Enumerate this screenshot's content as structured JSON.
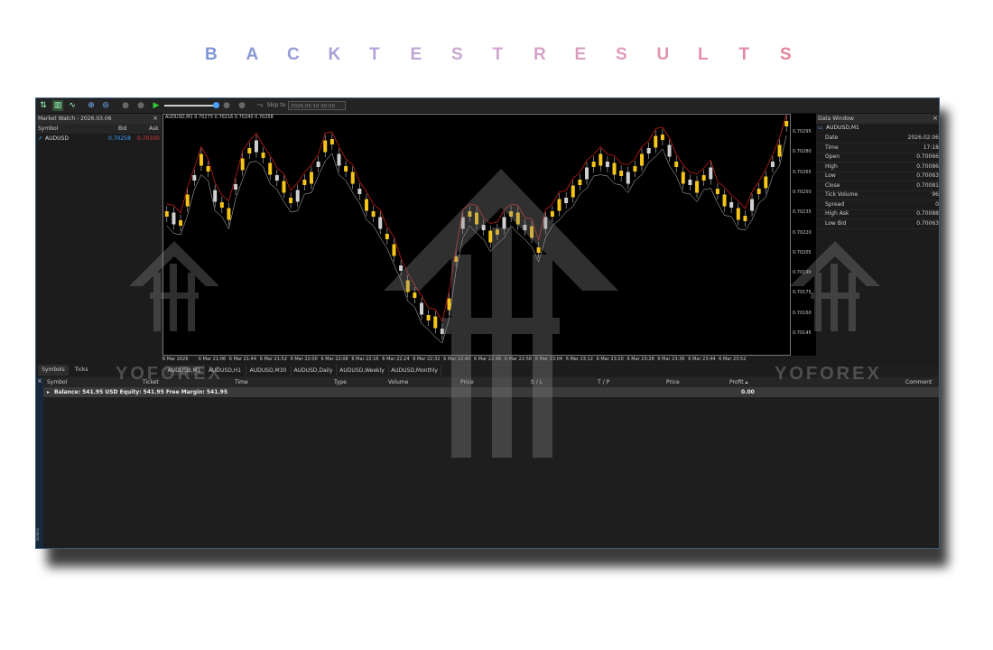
{
  "title_letters": [
    "B",
    "A",
    "C",
    "K",
    "T",
    "E",
    "S",
    "T",
    "R",
    "E",
    "S",
    "U",
    "L",
    "T",
    "S"
  ],
  "title_colors": [
    "#7f96d6",
    "#8a99d8",
    "#989cda",
    "#a69fd9",
    "#b3a2d8",
    "#bfa4d6",
    "#c9a6d4",
    "#d1a5cf",
    "#d6a2c9",
    "#db9ec2",
    "#df99bb",
    "#e294b3",
    "#e48fab",
    "#e589a2",
    "#e6839a"
  ],
  "toolbar": {
    "skip_label": "Skip to",
    "date_value": "2026.03.10 00:00"
  },
  "market_watch": {
    "title": "Market Watch - 2026.03.06",
    "col_symbol": "Symbol",
    "col_bid": "Bid",
    "col_ask": "Ask",
    "symbol": "AUDUSD",
    "bid": "0.70258",
    "ask": "0.70330",
    "tab_symbols": "Symbols",
    "tab_ticks": "Ticks"
  },
  "chart": {
    "header": "AUDUSD,M1  0.70273 0.70216 0.70240 0.70258",
    "y_ticks": [
      "0.70295",
      "0.70280",
      "0.70265",
      "0.70250",
      "0.70235",
      "0.70220",
      "0.70205",
      "0.70190",
      "0.70175",
      "0.70160",
      "0.70145"
    ],
    "x_ticks": [
      "6 Mar 2026",
      "6 Mar 21:06",
      "6 Mar 21:44",
      "6 Mar 21:52",
      "6 Mar 22:00",
      "6 Mar 22:08",
      "6 Mar 22:16",
      "6 Mar 22:24",
      "6 Mar 22:32",
      "6 Mar 22:40",
      "6 Mar 22:48",
      "6 Mar 22:56",
      "6 Mar 23:04",
      "6 Mar 23:12",
      "6 Mar 23:20",
      "6 Mar 23:28",
      "6 Mar 23:36",
      "6 Mar 23:44",
      "6 Mar 23:52"
    ],
    "tabs": [
      "AUDUSD,M1",
      "AUDUSD,H1",
      "AUDUSD,M30",
      "AUDUSD,Daily",
      "AUDUSD,Weekly",
      "AUDUSD,Monthly"
    ]
  },
  "data_window": {
    "title": "Data Window",
    "symbol": "AUDUSD,M1",
    "rows": [
      {
        "k": "Date",
        "v": "2026.02.06"
      },
      {
        "k": "Time",
        "v": "17:18"
      },
      {
        "k": "Open",
        "v": "0.70066"
      },
      {
        "k": "High",
        "v": "0.70086"
      },
      {
        "k": "Low",
        "v": "0.70063"
      },
      {
        "k": "Close",
        "v": "0.70081"
      },
      {
        "k": "Tick Volume",
        "v": "96"
      },
      {
        "k": "Spread",
        "v": "0"
      },
      {
        "k": "High Ask",
        "v": "0.70088"
      },
      {
        "k": "Low Bid",
        "v": "0.70063"
      }
    ]
  },
  "terminal": {
    "cols": [
      "Symbol",
      "Ticket",
      "Time",
      "Type",
      "Volume",
      "Price",
      "S / L",
      "T / P",
      "Price",
      "Profit",
      "Comment"
    ],
    "balance": "Balance: 541.95 USD  Equity: 541.95  Free Margin: 541.95",
    "profit": "0.00",
    "side_label": "Toolbox"
  },
  "watermark": "YOFOREX"
}
